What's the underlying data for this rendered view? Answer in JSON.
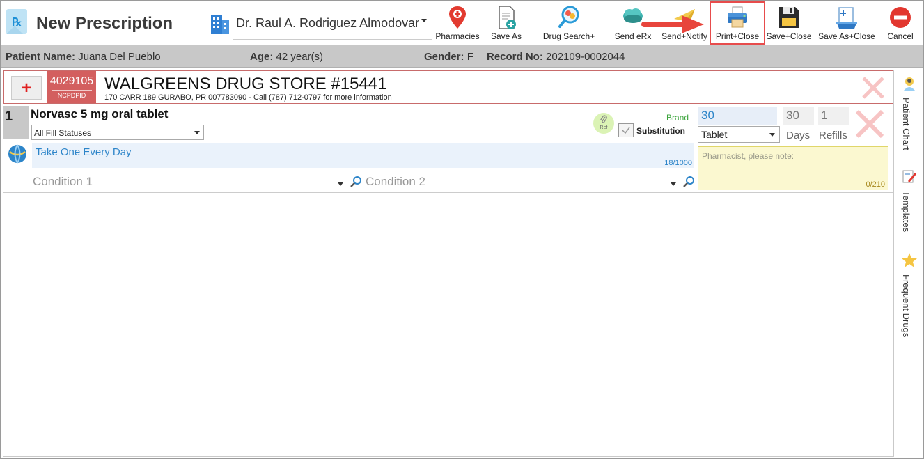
{
  "header": {
    "title": "New Prescription",
    "doctor": "Dr. Raul A. Rodriguez Almodovar",
    "toolbar": [
      {
        "label": "Pharmacies",
        "icon": "map-pin-icon"
      },
      {
        "label": "Save As",
        "icon": "document-add-icon"
      },
      {
        "label": "Drug Search+",
        "icon": "magnifier-pills-icon"
      },
      {
        "label": "Send eRx",
        "icon": "cloud-icon"
      },
      {
        "label": "Send+Notify",
        "icon": "paper-plane-icon"
      },
      {
        "label": "Print+Close",
        "icon": "printer-icon"
      },
      {
        "label": "Save+Close",
        "icon": "floppy-disk-icon"
      },
      {
        "label": "Save As+Close",
        "icon": "clipboard-add-icon"
      },
      {
        "label": "Cancel",
        "icon": "cancel-icon"
      }
    ],
    "highlight_color": "#e74c4c"
  },
  "patient": {
    "name_label": "Patient Name:",
    "name": "Juana Del Pueblo",
    "age_label": "Age:",
    "age": "42 year(s)",
    "gender_label": "Gender:",
    "gender": "F",
    "record_label": "Record No:",
    "record": "202109-0002044"
  },
  "pharmacy": {
    "ncpdp_id": "4029105",
    "ncpdp_label": "NCPDPID",
    "name": "WALGREENS DRUG STORE #15441",
    "address": "170 CARR 189 GURABO, PR 007783090 - Call (787) 712-0797 for more information"
  },
  "drug": {
    "line_number": "1",
    "name": "Norvasc 5 mg oral tablet",
    "fill_status": "All Fill Statuses",
    "sig": "Take One Every Day",
    "sig_count": "18/1000",
    "condition1_placeholder": "Condition 1",
    "condition2_placeholder": "Condition 2",
    "ref_label": "Ref",
    "brand_label": "Brand",
    "substitution_label": "Substitution",
    "quantity": "30",
    "unit": "Tablet",
    "days": "30",
    "days_label": "Days",
    "refills": "1",
    "refills_label": "Refills",
    "note_placeholder": "Pharmacist, please note:",
    "note_count": "0/210"
  },
  "side_panel": [
    {
      "label": "Patient Chart",
      "icon": "patient-chart-icon"
    },
    {
      "label": "Templates",
      "icon": "templates-icon"
    },
    {
      "label": "Frequent Drugs",
      "icon": "star-icon"
    }
  ]
}
